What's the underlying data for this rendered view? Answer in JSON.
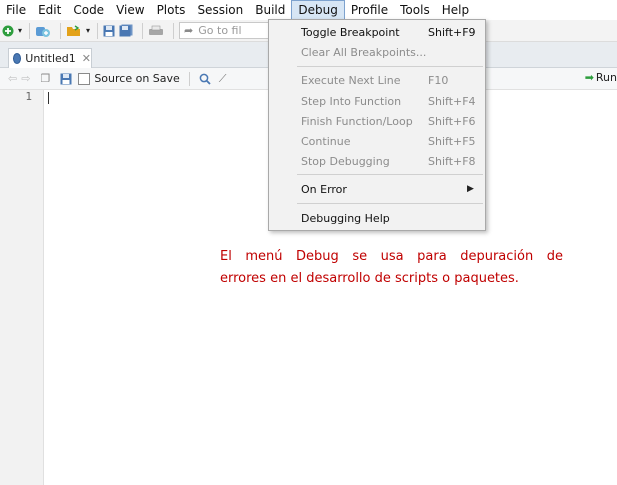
{
  "menubar": {
    "items": [
      "File",
      "Edit",
      "Code",
      "View",
      "Plots",
      "Session",
      "Build",
      "Debug",
      "Profile",
      "Tools",
      "Help"
    ],
    "active": "Debug"
  },
  "toolbar": {
    "goto_placeholder": "Go to fil"
  },
  "tab": {
    "title": "Untitled1"
  },
  "editor_toolbar": {
    "source_on_save": "Source on Save",
    "run_label": "Run"
  },
  "editor": {
    "line_number": "1"
  },
  "debug_menu": {
    "items": [
      {
        "label": "Toggle Breakpoint",
        "shortcut": "Shift+F9",
        "enabled": true
      },
      {
        "label": "Clear All Breakpoints...",
        "shortcut": "",
        "enabled": false
      },
      {
        "label": "Execute Next Line",
        "shortcut": "F10",
        "enabled": false
      },
      {
        "label": "Step Into Function",
        "shortcut": "Shift+F4",
        "enabled": false
      },
      {
        "label": "Finish Function/Loop",
        "shortcut": "Shift+F6",
        "enabled": false
      },
      {
        "label": "Continue",
        "shortcut": "Shift+F5",
        "enabled": false
      },
      {
        "label": "Stop Debugging",
        "shortcut": "Shift+F8",
        "enabled": false
      },
      {
        "label": "On Error",
        "shortcut": "",
        "enabled": true,
        "submenu": true
      },
      {
        "label": "Debugging Help",
        "shortcut": "",
        "enabled": true
      }
    ]
  },
  "annotation": {
    "line1": "El menú Debug se usa para depuración de",
    "line2": "errores en el desarrollo de scripts o paquetes.",
    "color": "#c00000"
  }
}
